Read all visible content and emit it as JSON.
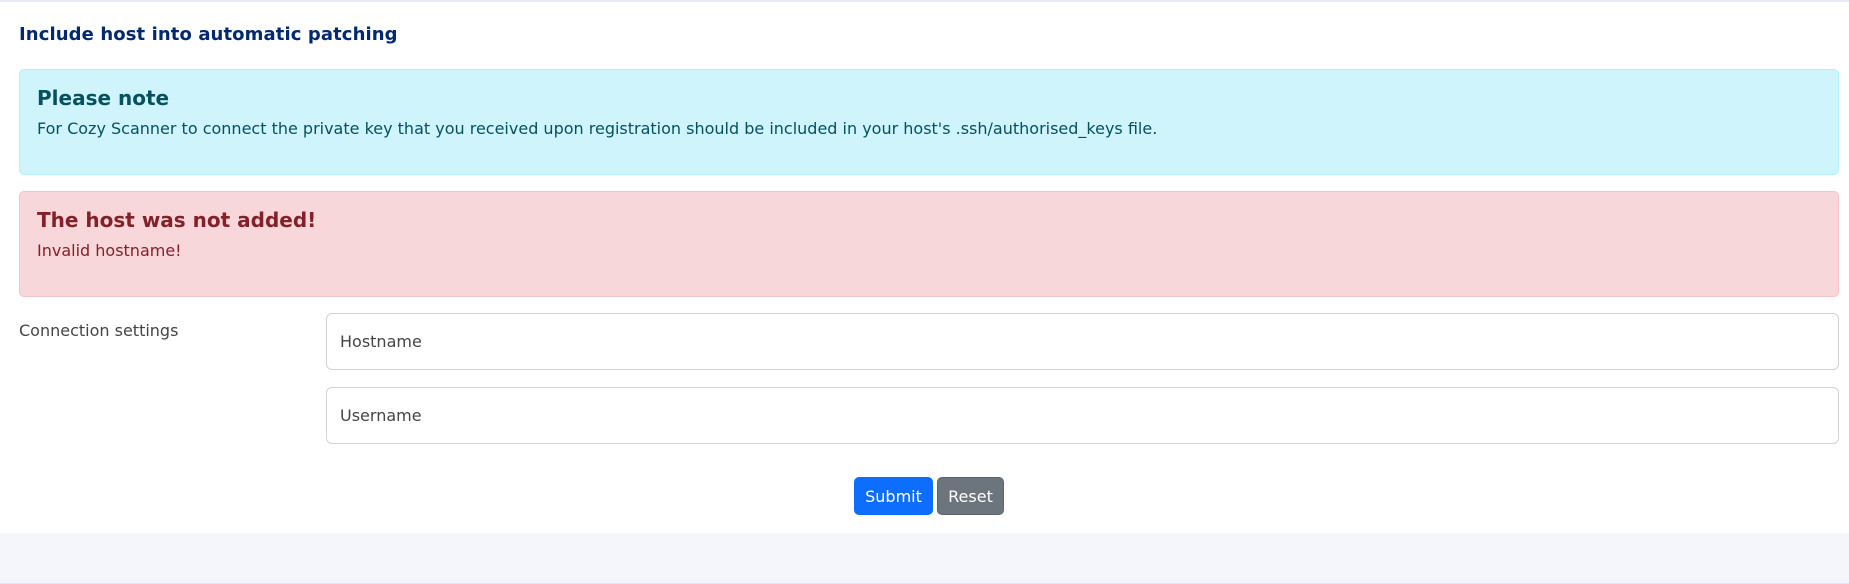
{
  "page": {
    "title": "Include host into automatic patching"
  },
  "info_alert": {
    "heading": "Please note",
    "text": "For Cozy Scanner to connect the private key that you received upon registration should be included in your host's .ssh/authorised_keys file."
  },
  "error_alert": {
    "heading": "The host was not added!",
    "text": "Invalid hostname!"
  },
  "form": {
    "section_label": "Connection settings",
    "hostname": {
      "value": "",
      "placeholder": "Hostname"
    },
    "username": {
      "value": "",
      "placeholder": "Username"
    },
    "submit_label": "Submit",
    "reset_label": "Reset"
  },
  "colors": {
    "title": "#012970",
    "info_bg": "#cff4fc",
    "info_text": "#055160",
    "danger_bg": "#f8d7da",
    "danger_text": "#842029",
    "primary": "#0d6efd",
    "secondary": "#6c757d"
  }
}
